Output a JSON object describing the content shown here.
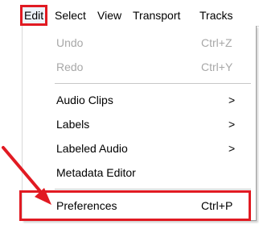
{
  "menu_bar": {
    "items": [
      {
        "label": "Edit"
      },
      {
        "label": "Select"
      },
      {
        "label": "View"
      },
      {
        "label": "Transport"
      },
      {
        "label": "Tracks"
      }
    ]
  },
  "edit_menu": {
    "undo": {
      "label": "Undo",
      "shortcut": "Ctrl+Z"
    },
    "redo": {
      "label": "Redo",
      "shortcut": "Ctrl+Y"
    },
    "audio_clips": {
      "label": "Audio Clips",
      "submenu": ">"
    },
    "labels": {
      "label": "Labels",
      "submenu": ">"
    },
    "labeled_audio": {
      "label": "Labeled Audio",
      "submenu": ">"
    },
    "metadata_editor": {
      "label": "Metadata Editor"
    },
    "preferences": {
      "label": "Preferences",
      "shortcut": "Ctrl+P"
    }
  },
  "colors": {
    "highlight": "#e11a22",
    "disabled_text": "#a8a8a8",
    "menu_background": "#ffffff"
  }
}
